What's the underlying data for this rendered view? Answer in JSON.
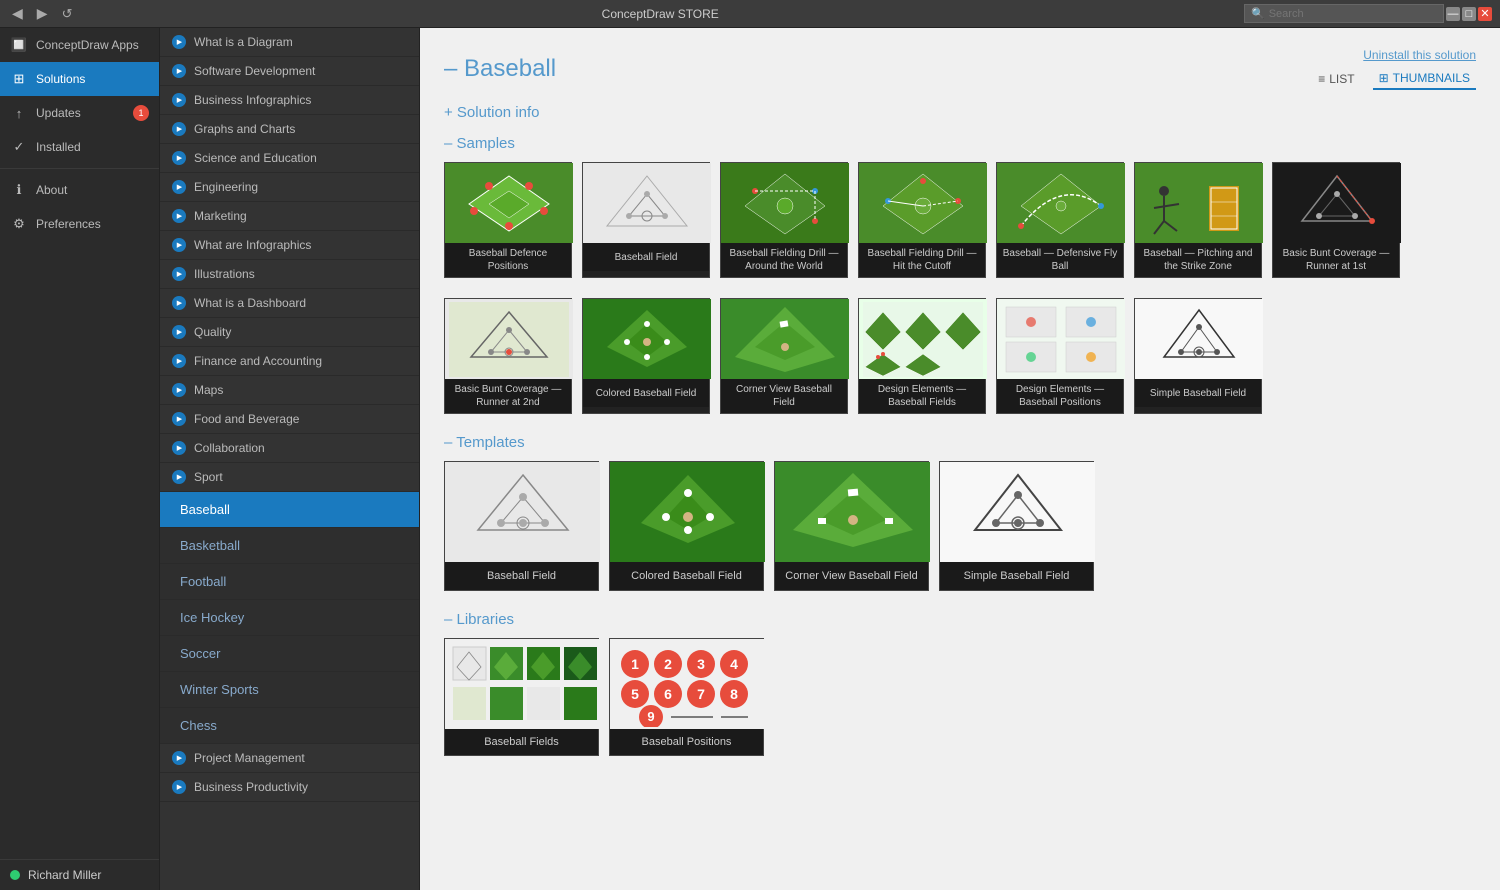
{
  "titlebar": {
    "title": "ConceptDraw STORE",
    "nav_back": "◀",
    "nav_forward": "▶",
    "nav_refresh": "↺",
    "search_placeholder": "Search",
    "btn_min": "—",
    "btn_max": "□",
    "btn_close": "✕"
  },
  "left_nav": {
    "items": [
      {
        "id": "conceptdraw-apps",
        "label": "ConceptDraw Apps",
        "icon": "🔲"
      },
      {
        "id": "solutions",
        "label": "Solutions",
        "icon": "⊞",
        "active": true
      },
      {
        "id": "updates",
        "label": "Updates",
        "icon": "↑",
        "badge": "1"
      },
      {
        "id": "installed",
        "label": "Installed",
        "icon": "✓"
      },
      {
        "id": "about",
        "label": "About",
        "icon": "ℹ"
      },
      {
        "id": "preferences",
        "label": "Preferences",
        "icon": "⚙"
      }
    ],
    "user": {
      "name": "Richard Miller",
      "status": "online"
    }
  },
  "middle_nav": {
    "solutions": [
      {
        "id": "what-is-diagram",
        "label": "What is a Diagram"
      },
      {
        "id": "software-dev",
        "label": "Software Development"
      },
      {
        "id": "business-infographics",
        "label": "Business Infographics"
      },
      {
        "id": "graphs-charts",
        "label": "Graphs and Charts"
      },
      {
        "id": "science-education",
        "label": "Science and Education"
      },
      {
        "id": "engineering",
        "label": "Engineering"
      },
      {
        "id": "marketing",
        "label": "Marketing"
      },
      {
        "id": "what-are-infographics",
        "label": "What are Infographics"
      },
      {
        "id": "illustrations",
        "label": "Illustrations"
      },
      {
        "id": "what-is-dashboard",
        "label": "What is a Dashboard"
      },
      {
        "id": "quality",
        "label": "Quality"
      },
      {
        "id": "finance-accounting",
        "label": "Finance and Accounting"
      },
      {
        "id": "maps",
        "label": "Maps"
      },
      {
        "id": "food-beverage",
        "label": "Food and Beverage"
      },
      {
        "id": "collaboration",
        "label": "Collaboration"
      },
      {
        "id": "sport",
        "label": "Sport"
      }
    ],
    "sport_subitems": [
      {
        "id": "baseball",
        "label": "Baseball",
        "active": true
      },
      {
        "id": "basketball",
        "label": "Basketball"
      },
      {
        "id": "football",
        "label": "Football"
      },
      {
        "id": "ice-hockey",
        "label": "Ice Hockey"
      },
      {
        "id": "soccer",
        "label": "Soccer"
      },
      {
        "id": "winter-sports",
        "label": "Winter Sports"
      },
      {
        "id": "chess",
        "label": "Chess"
      }
    ],
    "more_solutions": [
      {
        "id": "project-management",
        "label": "Project Management"
      },
      {
        "id": "business-productivity",
        "label": "Business Productivity"
      }
    ]
  },
  "content": {
    "title": "Baseball",
    "uninstall_label": "Uninstall this solution",
    "solution_info_label": "+ Solution info",
    "samples_label": "– Samples",
    "templates_label": "– Templates",
    "libraries_label": "– Libraries",
    "view_list": "LIST",
    "view_thumbnails": "THUMBNAILS",
    "samples": [
      {
        "id": "s1",
        "label": "Baseball Defence Positions",
        "type": "green"
      },
      {
        "id": "s2",
        "label": "Baseball Field",
        "type": "light"
      },
      {
        "id": "s3",
        "label": "Baseball Fielding Drill — Around the World",
        "type": "green"
      },
      {
        "id": "s4",
        "label": "Baseball Fielding Drill — Hit the Cutoff",
        "type": "green"
      },
      {
        "id": "s5",
        "label": "Baseball — Defensive Fly Ball",
        "type": "green"
      },
      {
        "id": "s6",
        "label": "Baseball — Pitching and the Strike Zone",
        "type": "green_player"
      },
      {
        "id": "s7",
        "label": "Basic Bunt Coverage — Runner at 1st",
        "type": "dark"
      },
      {
        "id": "s8",
        "label": "Basic Bunt Coverage — Runner at 2nd",
        "type": "light2"
      },
      {
        "id": "s9",
        "label": "Colored Baseball Field",
        "type": "green"
      },
      {
        "id": "s10",
        "label": "Corner View Baseball Field",
        "type": "green3d"
      },
      {
        "id": "s11",
        "label": "Design Elements — Baseball Fields",
        "type": "multi"
      },
      {
        "id": "s12",
        "label": "Design Elements — Baseball Positions",
        "type": "multi2"
      },
      {
        "id": "s13",
        "label": "Simple Baseball Field",
        "type": "simple"
      }
    ],
    "templates": [
      {
        "id": "t1",
        "label": "Baseball Field",
        "type": "light"
      },
      {
        "id": "t2",
        "label": "Colored Baseball Field",
        "type": "green"
      },
      {
        "id": "t3",
        "label": "Corner View Baseball Field",
        "type": "green3d"
      },
      {
        "id": "t4",
        "label": "Simple Baseball Field",
        "type": "simple"
      }
    ],
    "libraries": [
      {
        "id": "l1",
        "label": "Baseball Fields",
        "type": "lib_fields"
      },
      {
        "id": "l2",
        "label": "Baseball Positions",
        "type": "lib_positions"
      }
    ]
  }
}
